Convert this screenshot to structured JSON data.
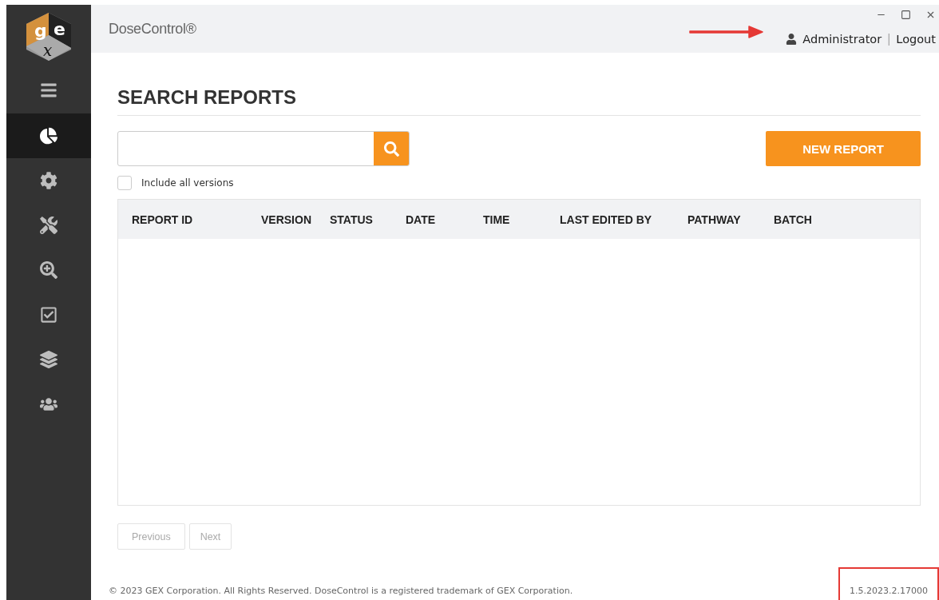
{
  "logo": {
    "letters": [
      "g",
      "e",
      "x"
    ]
  },
  "header": {
    "app_title": "DoseControl®",
    "user": "Administrator",
    "separator": "|",
    "logout": "Logout"
  },
  "sidebar": {
    "items": [
      {
        "kind": "reports",
        "selected": true
      },
      {
        "kind": "settings",
        "selected": false
      },
      {
        "kind": "tools",
        "selected": false
      },
      {
        "kind": "inspect",
        "selected": false
      },
      {
        "kind": "checklist",
        "selected": false
      },
      {
        "kind": "layers",
        "selected": false
      },
      {
        "kind": "users",
        "selected": false
      }
    ]
  },
  "page": {
    "title": "SEARCH REPORTS"
  },
  "new_report_button": "NEW REPORT",
  "include_all_versions": {
    "label": "Include all versions",
    "checked": false
  },
  "table": {
    "columns": [
      "REPORT ID",
      "VERSION",
      "STATUS",
      "DATE",
      "TIME",
      "LAST EDITED BY",
      "PATHWAY",
      "BATCH"
    ]
  },
  "pagination": [
    {
      "label": "Previous",
      "disabled": true
    },
    {
      "label": "Next",
      "disabled": true
    }
  ],
  "footer": {
    "copyright": "© 2023 GEX Corporation. All Rights Reserved. DoseControl is a registered trademark of GEX Corporation.",
    "version": "1.5.2023.2.17000"
  }
}
